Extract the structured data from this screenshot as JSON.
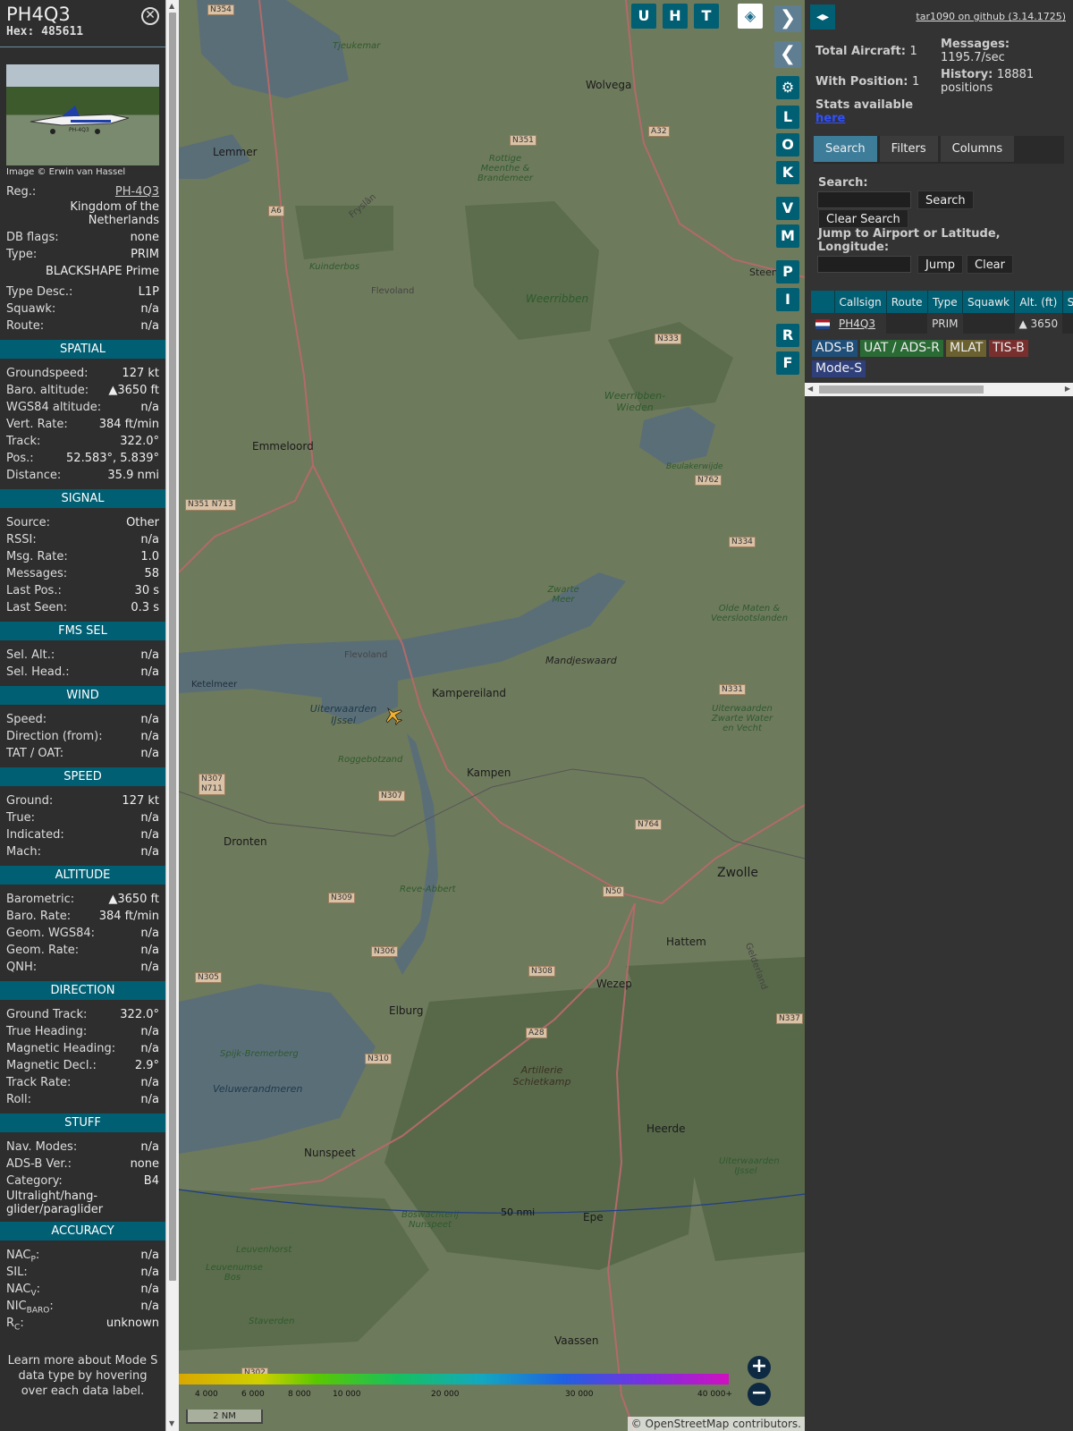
{
  "info": {
    "callsign": "PH4Q3",
    "hex_label": "Hex:",
    "hex": "485611",
    "close_icon": "close-icon",
    "image_credit": "Image © Erwin van Hassel",
    "photo_reg": "PH-4Q3",
    "reg_label": "Reg.:",
    "reg": "PH-4Q3",
    "country": "Kingdom of the Netherlands",
    "dbflags_label": "DB flags:",
    "dbflags": "none",
    "type_label": "Type:",
    "type": "PRIM",
    "type_full": "BLACKSHAPE Prime",
    "typedesc_label": "Type Desc.:",
    "typedesc": "L1P",
    "squawk_label": "Squawk:",
    "squawk": "n/a",
    "route_label": "Route:",
    "route": "n/a"
  },
  "spatial": {
    "title": "SPATIAL",
    "rows": [
      {
        "k": "Groundspeed:",
        "v": "127 kt"
      },
      {
        "k": "Baro. altitude:",
        "v": "▲3650 ft"
      },
      {
        "k": "WGS84 altitude:",
        "v": "n/a"
      },
      {
        "k": "Vert. Rate:",
        "v": "384 ft/min"
      },
      {
        "k": "Track:",
        "v": "322.0°"
      },
      {
        "k": "Pos.:",
        "v": "52.583°, 5.839°"
      },
      {
        "k": "Distance:",
        "v": "35.9 nmi"
      }
    ]
  },
  "signal": {
    "title": "SIGNAL",
    "rows": [
      {
        "k": "Source:",
        "v": "Other"
      },
      {
        "k": "RSSI:",
        "v": "n/a"
      },
      {
        "k": "Msg. Rate:",
        "v": "1.0"
      },
      {
        "k": "Messages:",
        "v": "58"
      },
      {
        "k": "Last Pos.:",
        "v": "30 s"
      },
      {
        "k": "Last Seen:",
        "v": "0.3 s"
      }
    ]
  },
  "fmssel": {
    "title": "FMS SEL",
    "rows": [
      {
        "k": "Sel. Alt.:",
        "v": "n/a"
      },
      {
        "k": "Sel. Head.:",
        "v": "n/a"
      }
    ]
  },
  "wind": {
    "title": "WIND",
    "rows": [
      {
        "k": "Speed:",
        "v": "n/a"
      },
      {
        "k": "Direction (from):",
        "v": "n/a"
      },
      {
        "k": "TAT / OAT:",
        "v": "n/a"
      }
    ]
  },
  "speed": {
    "title": "SPEED",
    "rows": [
      {
        "k": "Ground:",
        "v": "127 kt"
      },
      {
        "k": "True:",
        "v": "n/a"
      },
      {
        "k": "Indicated:",
        "v": "n/a"
      },
      {
        "k": "Mach:",
        "v": "n/a"
      }
    ]
  },
  "altitude": {
    "title": "ALTITUDE",
    "rows": [
      {
        "k": "Barometric:",
        "v": "▲3650 ft"
      },
      {
        "k": "Baro. Rate:",
        "v": "384 ft/min"
      },
      {
        "k": "Geom. WGS84:",
        "v": "n/a"
      },
      {
        "k": "Geom. Rate:",
        "v": "n/a"
      },
      {
        "k": "QNH:",
        "v": "n/a"
      }
    ]
  },
  "direction": {
    "title": "DIRECTION",
    "rows": [
      {
        "k": "Ground Track:",
        "v": "322.0°"
      },
      {
        "k": "True Heading:",
        "v": "n/a"
      },
      {
        "k": "Magnetic Heading:",
        "v": "n/a"
      },
      {
        "k": "Magnetic Decl.:",
        "v": "2.9°"
      },
      {
        "k": "Track Rate:",
        "v": "n/a"
      },
      {
        "k": "Roll:",
        "v": "n/a"
      }
    ]
  },
  "stuff": {
    "title": "STUFF",
    "rows": [
      {
        "k": "Nav. Modes:",
        "v": "n/a"
      },
      {
        "k": "ADS-B Ver.:",
        "v": "none"
      },
      {
        "k": "Category:",
        "v": "B4"
      }
    ],
    "category_text": "Ultralight/hang-glider/paraglider"
  },
  "accuracy": {
    "title": "ACCURACY",
    "nacp": "NAC",
    "nacp_sub": "P",
    "nacp_v": "n/a",
    "sil": "SIL:",
    "sil_v": "n/a",
    "nacv": "NAC",
    "nacv_sub": "V",
    "nacv_v": "n/a",
    "nic": "NIC",
    "nic_sub": "BARO",
    "nic_v": "n/a",
    "rc": "R",
    "rc_sub": "C",
    "rc_v": "unknown"
  },
  "learn_more": "Learn more about Mode S data type by hovering over each data label.",
  "map": {
    "buttons_top": [
      "U",
      "H",
      "T"
    ],
    "side_buttons": [
      "L",
      "O",
      "K",
      "V",
      "M",
      "P",
      "I",
      "R",
      "F"
    ],
    "places": [
      "Lemmer",
      "Wolvega",
      "Emmeloord",
      "Kampereiland",
      "Kampen",
      "Dronten",
      "Zwolle",
      "Hattem",
      "Wezep",
      "Elburg",
      "Heerde",
      "Nunspeet",
      "Epe",
      "Vaassen",
      "Mandjeswaard",
      "Steenw",
      "Flevoland",
      "Flevoland",
      "Ketelmeer"
    ],
    "nature": [
      "Tjeukemar",
      "Rottige Meenthe & Brandemeer",
      "Kuinderbos",
      "Weerribben",
      "Weerribben-Wieden",
      "Zwarte Meer",
      "Olde Maten & Veerslootslanden",
      "Uiterwaarden IJssel",
      "Roggebotzand",
      "Reve-Abbert",
      "Uiterwaarden Zwarte Water en Vecht",
      "Artillerie Schietkamp",
      "Spijk-Bremerberg",
      "Veluwerandmeren",
      "Boswachterij Nunspeet",
      "Leuvenhorst",
      "Leuvenumse Bos",
      "Staverden",
      "Uiterwaarden IJssel",
      "Beulakerwijde",
      "Fryslân",
      "Gelderland"
    ],
    "roads": [
      "N354",
      "N351",
      "A32",
      "A6",
      "N333",
      "N762",
      "N351 N713",
      "N334",
      "N331",
      "N307 N711",
      "N307",
      "N764",
      "N309",
      "N50",
      "N306",
      "N308",
      "N305",
      "A28",
      "N310",
      "N337",
      "N302"
    ],
    "range_ring": "50 nmi",
    "legend_ticks": [
      "4 000",
      "6 000",
      "8 000",
      "10 000",
      "20 000",
      "30 000",
      "40 000+"
    ],
    "scale": "2 NM",
    "attribution_prefix": "©",
    "attribution_link": "OpenStreetMap",
    "attribution_suffix": "contributors.",
    "zoom_in": "+",
    "zoom_out": "−"
  },
  "right": {
    "github": "tar1090 on github (3.14.1725)",
    "total_aircraft_label": "Total Aircraft:",
    "total_aircraft": "1",
    "with_position_label": "With Position:",
    "with_position": "1",
    "messages_label": "Messages:",
    "messages": "1195.7/sec",
    "history_label": "History:",
    "history": "18881 positions",
    "stats_label": "Stats available",
    "stats_link": "here",
    "tabs": [
      "Search",
      "Filters",
      "Columns"
    ],
    "search_label": "Search:",
    "search_button": "Search",
    "clear_search_button": "Clear Search",
    "jump_label": "Jump to Airport or Latitude, Longitude:",
    "jump_button": "Jump",
    "clear_button": "Clear",
    "table_headers": [
      "",
      "Callsign",
      "Route",
      "Type",
      "Squawk",
      "Alt. (ft)",
      "Spd"
    ],
    "table_rows": [
      {
        "callsign": "PH4Q3",
        "route": "",
        "type": "PRIM",
        "squawk": "",
        "alt": "▲  3650",
        "spd": ""
      }
    ],
    "sources": [
      "ADS-B",
      "UAT / ADS-R",
      "MLAT",
      "TIS-B",
      "Mode-S"
    ],
    "source_colors": [
      "#1f4e79",
      "#2a6b35",
      "#6b6130",
      "#7a2f2f",
      "#2f3f7a"
    ]
  }
}
